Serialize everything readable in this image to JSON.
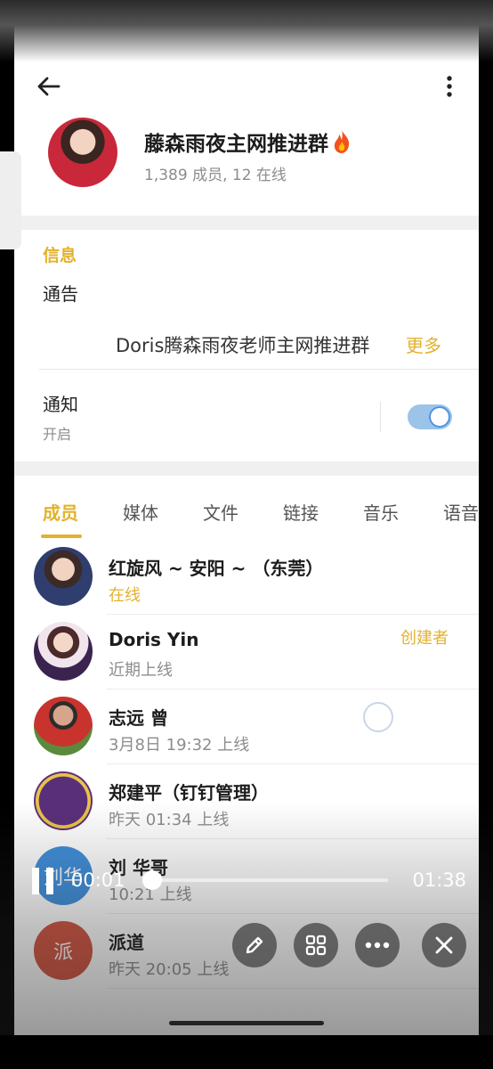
{
  "group": {
    "title": "藤森雨夜主网推进群",
    "subtitle": "1,389 成员, 12 在线"
  },
  "info": {
    "section_label": "信息",
    "notice_title": "通告",
    "notice_text": "Doris腾森雨夜老师主网推进群",
    "more_label": "更多",
    "notify_title": "通知",
    "notify_state": "开启",
    "notify_enabled": true
  },
  "tabs": [
    {
      "label": "成员",
      "active": true
    },
    {
      "label": "媒体"
    },
    {
      "label": "文件"
    },
    {
      "label": "链接"
    },
    {
      "label": "音乐"
    },
    {
      "label": "语音"
    }
  ],
  "members": [
    {
      "name": "红旋风 ~ 安阳 ~ （东莞）",
      "status": "在线",
      "online": true
    },
    {
      "name": "Doris Yin",
      "status": "近期上线",
      "badge": "创建者"
    },
    {
      "name": "志远 曾",
      "status": "3月8日 19:32 上线"
    },
    {
      "name": "郑建平（钉钉管理）",
      "status": "昨天 01:34 上线"
    },
    {
      "name": "刘 华哥",
      "status": "10:21 上线",
      "avatar_text": "刘华",
      "avatar_color": "#3f8fdc"
    },
    {
      "name": "派道",
      "status": "昨天 20:05 上线",
      "avatar_text": "派",
      "avatar_color": "#d2533f"
    }
  ],
  "player": {
    "current_time": "00:01",
    "total_time": "01:38",
    "progress": 0.01
  },
  "colors": {
    "accent": "#e3b12b",
    "toggle": "#4b93dd"
  }
}
